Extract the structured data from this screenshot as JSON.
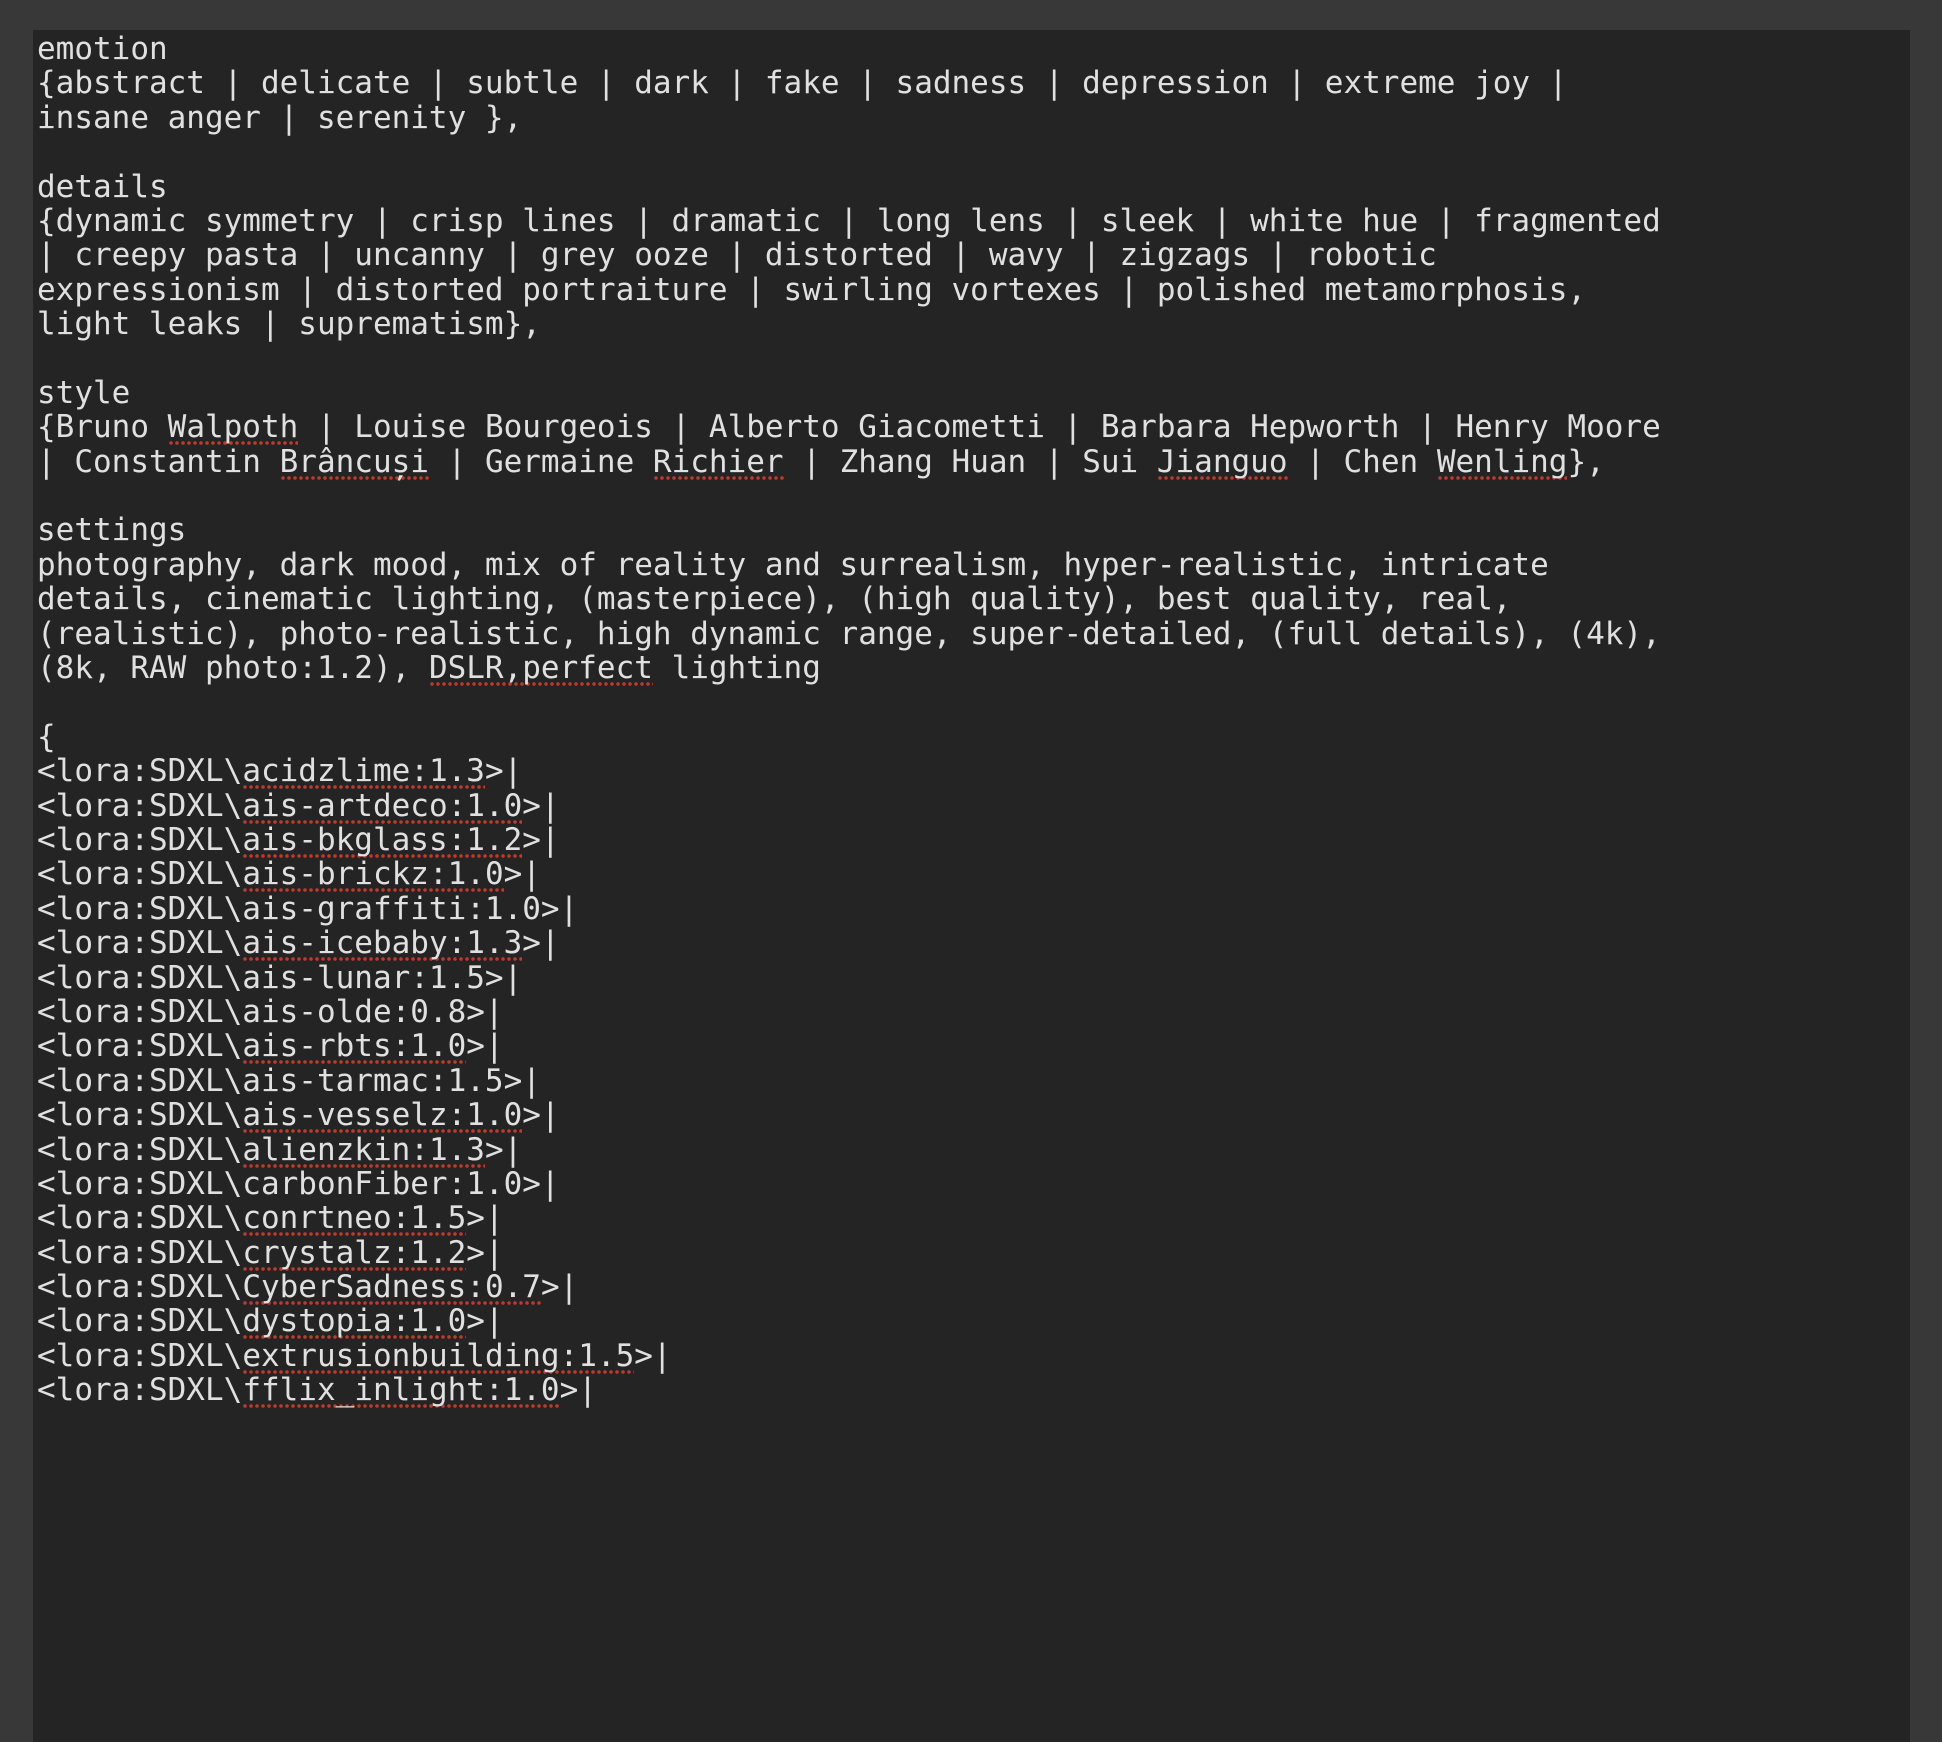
{
  "app": {
    "kind": "prompt-textarea",
    "colors": {
      "window_background": "#383838",
      "panel_background": "#242424",
      "text": "#e0e0e0",
      "spellcheck_underline": "#c0392b"
    }
  },
  "prompt": {
    "sections": [
      {
        "name": "emotion",
        "heading": "emotion",
        "lines": [
          "{abstract | delicate | subtle | dark | fake | sadness | depression | extreme joy |",
          "insane anger | serenity },"
        ]
      },
      {
        "name": "details",
        "heading": "details",
        "lines": [
          "{dynamic symmetry | crisp lines | dramatic | long lens | sleek | white hue | fragmented",
          "| creepy pasta | uncanny | grey ooze | distorted | wavy | zigzags | robotic",
          "expressionism | distorted portraiture | swirling vortexes | polished metamorphosis,",
          "light leaks | suprematism},"
        ]
      },
      {
        "name": "style",
        "heading": "style",
        "lines": [
          "{Bruno Walpoth | Louise Bourgeois | Alberto Giacometti | Barbara Hepworth | Henry Moore",
          "| Constantin Brâncuși | Germaine Richier | Zhang Huan | Sui Jianguo | Chen Wenling},"
        ]
      },
      {
        "name": "settings",
        "heading": "settings",
        "lines": [
          "photography, dark mood, mix of reality and surrealism, hyper-realistic, intricate",
          "details, cinematic lighting, (masterpiece), (high quality), best quality, real,",
          "(realistic), photo-realistic, high dynamic range, super-detailed, (full details), (4k),",
          "(8k, RAW photo:1.2), DSLR,perfect lighting"
        ]
      }
    ],
    "lora_block": {
      "open_brace": "{",
      "prefix": "<lora:SDXL\\",
      "suffix": ">|",
      "entries": [
        {
          "name": "acidzlime",
          "weight": "1.3",
          "misspelled": true
        },
        {
          "name": "ais-artdeco",
          "weight": "1.0",
          "misspelled": true
        },
        {
          "name": "ais-bkglass",
          "weight": "1.2",
          "misspelled": true
        },
        {
          "name": "ais-brickz",
          "weight": "1.0",
          "misspelled": true
        },
        {
          "name": "ais-graffiti",
          "weight": "1.0",
          "misspelled": false
        },
        {
          "name": "ais-icebaby",
          "weight": "1.3",
          "misspelled": true
        },
        {
          "name": "ais-lunar",
          "weight": "1.5",
          "misspelled": false
        },
        {
          "name": "ais-olde",
          "weight": "0.8",
          "misspelled": false
        },
        {
          "name": "ais-rbts",
          "weight": "1.0",
          "misspelled": true
        },
        {
          "name": "ais-tarmac",
          "weight": "1.5",
          "misspelled": false
        },
        {
          "name": "ais-vesselz",
          "weight": "1.0",
          "misspelled": true
        },
        {
          "name": "alienzkin",
          "weight": "1.3",
          "misspelled": true
        },
        {
          "name": "carbonFiber",
          "weight": "1.0",
          "misspelled": false
        },
        {
          "name": "conrtneo",
          "weight": "1.5",
          "misspelled": true
        },
        {
          "name": "crystalz",
          "weight": "1.2",
          "misspelled": true
        },
        {
          "name": "CyberSadness",
          "weight": "0.7",
          "misspelled": true
        },
        {
          "name": "dystopia",
          "weight": "1.0",
          "misspelled": true
        },
        {
          "name": "extrusionbuilding",
          "weight": "1.5",
          "misspelled": true
        },
        {
          "name": "fflix_inlight",
          "weight": "1.0",
          "misspelled": true
        }
      ]
    },
    "spellcheck_words": [
      "Walpoth",
      "Brâncuși",
      "Richier",
      "Jianguo",
      "Wenling",
      "DSLR,perfect"
    ]
  }
}
